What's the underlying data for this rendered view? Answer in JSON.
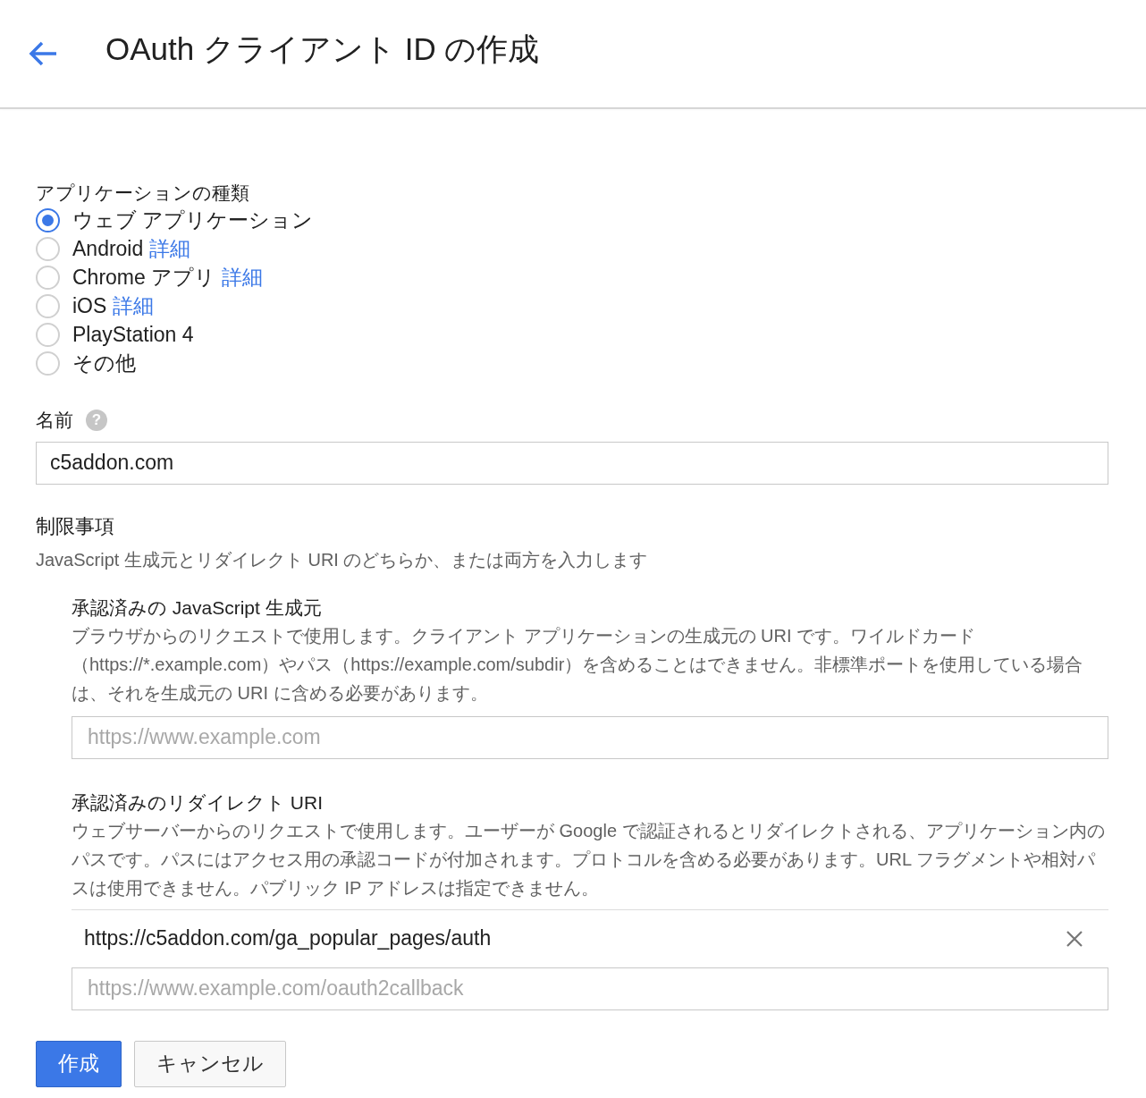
{
  "header": {
    "title": "OAuth クライアント ID の作成"
  },
  "app_type": {
    "label": "アプリケーションの種類",
    "options": [
      {
        "label": "ウェブ アプリケーション",
        "selected": true
      },
      {
        "label": "Android",
        "link": "詳細",
        "selected": false
      },
      {
        "label": "Chrome アプリ",
        "link": "詳細",
        "selected": false
      },
      {
        "label": "iOS",
        "link": "詳細",
        "selected": false
      },
      {
        "label": "PlayStation 4",
        "selected": false
      },
      {
        "label": "その他",
        "selected": false
      }
    ]
  },
  "name_field": {
    "label": "名前",
    "help": "?",
    "value": "c5addon.com"
  },
  "restrictions": {
    "title": "制限事項",
    "description": "JavaScript 生成元とリダイレクト URI のどちらか、または両方を入力します",
    "sections": [
      {
        "title": "承認済みの JavaScript 生成元",
        "description": "ブラウザからのリクエストで使用します。クライアント アプリケーションの生成元の URI です。ワイルドカード（https://*.example.com）やパス（https://example.com/subdir）を含めることはできません。非標準ポートを使用している場合は、それを生成元の URI に含める必要があります。",
        "placeholder": "https://www.example.com"
      },
      {
        "title": "承認済みのリダイレクト URI",
        "description": "ウェブサーバーからのリクエストで使用します。ユーザーが Google で認証されるとリダイレクトされる、アプリケーション内のパスです。パスにはアクセス用の承認コードが付加されます。プロトコルを含める必要があります。URL フラグメントや相対パスは使用できません。パブリック IP アドレスは指定できません。",
        "entries": [
          "https://c5addon.com/ga_popular_pages/auth"
        ],
        "placeholder": "https://www.example.com/oauth2callback"
      }
    ]
  },
  "buttons": [
    {
      "label": "作成",
      "kind": "primary"
    },
    {
      "label": "キャンセル",
      "kind": "secondary"
    }
  ]
}
